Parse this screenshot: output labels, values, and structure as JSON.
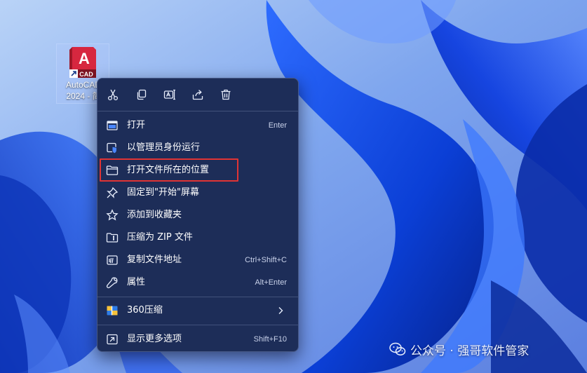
{
  "desktop": {
    "shortcut": {
      "name_line1": "AutoCAD",
      "name_line2": "2024 - 简",
      "logo_letter": "A",
      "logo_sub": "CAD"
    }
  },
  "context_menu": {
    "quick_actions": [
      {
        "name": "cut",
        "icon": "scissors-icon"
      },
      {
        "name": "copy",
        "icon": "copy-icon"
      },
      {
        "name": "rename",
        "icon": "rename-icon"
      },
      {
        "name": "share",
        "icon": "share-icon"
      },
      {
        "name": "delete",
        "icon": "trash-icon"
      }
    ],
    "items": [
      {
        "label": "打开",
        "shortcut": "Enter",
        "icon": "open-window-icon"
      },
      {
        "label": "以管理员身份运行",
        "shortcut": "",
        "icon": "admin-shield-icon"
      },
      {
        "label": "打开文件所在的位置",
        "shortcut": "",
        "icon": "folder-icon",
        "highlighted": true
      },
      {
        "label": "固定到\"开始\"屏幕",
        "shortcut": "",
        "icon": "pin-icon"
      },
      {
        "label": "添加到收藏夹",
        "shortcut": "",
        "icon": "star-icon"
      },
      {
        "label": "压缩为 ZIP 文件",
        "shortcut": "",
        "icon": "zip-folder-icon"
      },
      {
        "label": "复制文件地址",
        "shortcut": "Ctrl+Shift+C",
        "icon": "copy-path-icon"
      },
      {
        "label": "属性",
        "shortcut": "Alt+Enter",
        "icon": "wrench-icon"
      },
      {
        "label": "360压缩",
        "shortcut": "",
        "icon": "360-zip-icon",
        "submenu": true
      },
      {
        "label": "显示更多选项",
        "shortcut": "Shift+F10",
        "icon": "more-options-icon"
      }
    ]
  },
  "watermark": {
    "text": "公众号 · 强哥软件管家"
  },
  "colors": {
    "menu_bg": "#1d2d58",
    "highlight_border": "#e03434",
    "autocad_red": "#d7273f",
    "wallpaper_blue": "#1a4fe0"
  }
}
